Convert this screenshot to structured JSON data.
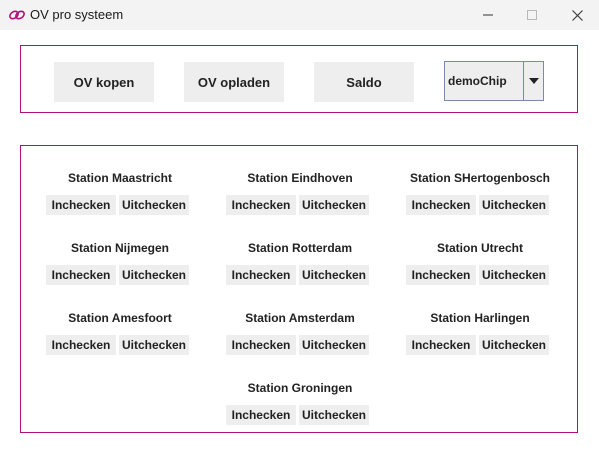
{
  "window": {
    "title": "OV pro systeem",
    "app_icon": "link-chain-icon"
  },
  "top": {
    "buttons": [
      "OV kopen",
      "OV opladen",
      "Saldo"
    ],
    "card_select": {
      "value": "demoChip"
    }
  },
  "stations": {
    "checkin_label": "Inchecken",
    "checkout_label": "Uitchecken",
    "items": [
      {
        "name": "Station Maastricht"
      },
      {
        "name": "Station Eindhoven"
      },
      {
        "name": "Station SHertogenbosch"
      },
      {
        "name": "Station Nijmegen"
      },
      {
        "name": "Station Rotterdam"
      },
      {
        "name": "Station Utrecht"
      },
      {
        "name": "Station Amesfoort"
      },
      {
        "name": "Station Amsterdam"
      },
      {
        "name": "Station Harlingen"
      },
      {
        "name": "Station Groningen"
      }
    ]
  },
  "colors": {
    "panel_border": "#b0107a",
    "button_bg": "#eeeeee",
    "combo_border": "#7a8ba8"
  }
}
